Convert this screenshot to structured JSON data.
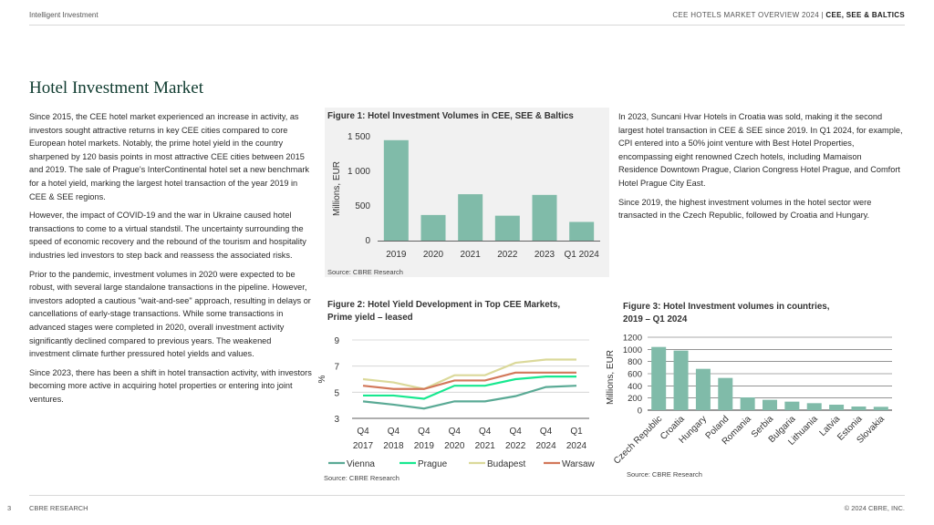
{
  "header": {
    "left": "Intelligent Investment",
    "right_main": "CEE HOTELS MARKET OVERVIEW 2024  |  ",
    "right_bold": "CEE, SEE & BALTICS"
  },
  "page_title": "Hotel Investment Market",
  "left_paragraphs": [
    "Since 2015, the CEE hotel market experienced an increase in activity, as investors sought attractive returns in key CEE cities compared to core European hotel markets. Notably, the prime hotel yield in the country sharpened by 120 basis points in most attractive CEE cities between 2015 and 2019. The sale of Prague's InterContinental hotel set a new benchmark for a hotel yield, marking the largest hotel transaction of the year 2019 in CEE & SEE regions.",
    "However, the impact of COVID-19 and the war in Ukraine caused hotel transactions to come to a virtual standstil. The uncertainty surrounding the speed of economic recovery and the rebound of the tourism and hospitality industries led investors to step back and reassess the associated risks.",
    "Prior to the pandemic, investment volumes in 2020 were expected to be robust, with several large standalone transactions in the pipeline. However, investors adopted a cautious \"wait-and-see\" approach, resulting in delays or cancellations of early-stage transactions. While some transactions in advanced stages were completed in 2020, overall investment activity significantly declined compared to previous years. The weakened investment climate further pressured hotel yields and values.",
    "Since 2023, there has been a shift in hotel transaction activity, with investors becoming more active in acquiring hotel properties or entering into joint ventures."
  ],
  "right_paragraphs": [
    "In 2023, Suncani Hvar Hotels in Croatia was sold, making it the second largest hotel transaction in CEE & SEE since 2019.  In Q1 2024, for example, CPI entered into a 50% joint venture with Best Hotel Properties, encompassing eight renowned Czech hotels, including Mamaison Residence Downtown Prague, Clarion Congress Hotel Prague, and Comfort Hotel Prague City East.",
    "Since 2019, the highest investment volumes in the hotel sector were transacted in the Czech Republic, followed by Croatia and Hungary."
  ],
  "figure1": {
    "title": "Figure 1: Hotel Investment Volumes in CEE, SEE & Baltics",
    "source": "Source: CBRE Research"
  },
  "figure2": {
    "title_line1": "Figure 2: Hotel Yield Development in Top CEE Markets,",
    "title_line2": "Prime yield – leased",
    "source": "Source: CBRE Research"
  },
  "figure3": {
    "title_line1": "Figure 3: Hotel Investment volumes in countries,",
    "title_line2": "2019 – Q1 2024",
    "source": "Source: CBRE Research"
  },
  "chart_data": [
    {
      "type": "bar",
      "title": "Figure 1: Hotel Investment Volumes in CEE, SEE & Baltics",
      "ylabel": "Millions, EUR",
      "categories": [
        "2019",
        "2020",
        "2021",
        "2022",
        "2023",
        "Q1 2024"
      ],
      "values": [
        1450,
        370,
        670,
        360,
        660,
        270
      ],
      "ylim": [
        0,
        1500
      ],
      "yticks": [
        "0",
        "500",
        "1 000",
        "1 500"
      ],
      "ytick_values": [
        0,
        500,
        1000,
        1500
      ],
      "grid": false,
      "color": "#80bba9"
    },
    {
      "type": "line",
      "title": "Figure 2: Hotel Yield Development in Top CEE Markets, Prime yield – leased",
      "ylabel": "%",
      "categories": [
        [
          "Q4",
          "2017"
        ],
        [
          "Q4",
          "2018"
        ],
        [
          "Q4",
          "2019"
        ],
        [
          "Q4",
          "2020"
        ],
        [
          "Q4",
          "2021"
        ],
        [
          "Q4",
          "2022"
        ],
        [
          "Q4",
          "2024"
        ],
        [
          "Q1",
          "2024"
        ]
      ],
      "ylim": [
        3,
        9
      ],
      "yticks": [
        3,
        5,
        7,
        9
      ],
      "grid": true,
      "legend": "bottom",
      "series": [
        {
          "name": "Vienna",
          "color": "#5aaa95",
          "values": [
            4.3,
            4.05,
            3.75,
            4.3,
            4.3,
            4.7,
            5.4,
            5.5
          ]
        },
        {
          "name": "Prague",
          "color": "#17e88f",
          "values": [
            4.75,
            4.75,
            4.5,
            5.5,
            5.5,
            6.0,
            6.2,
            6.2
          ]
        },
        {
          "name": "Budapest",
          "color": "#dbd99a",
          "values": [
            6.0,
            5.75,
            5.25,
            6.3,
            6.3,
            7.25,
            7.5,
            7.5
          ]
        },
        {
          "name": "Warsaw",
          "color": "#d2785a",
          "values": [
            5.5,
            5.25,
            5.25,
            5.9,
            5.9,
            6.5,
            6.5,
            6.5
          ]
        }
      ]
    },
    {
      "type": "bar",
      "title": "Figure 3: Hotel Investment volumes in countries, 2019 – Q1 2024",
      "ylabel": "Millions, EUR",
      "categories": [
        "Czech Republic",
        "Croatia",
        "Hungary",
        "Poland",
        "Romania",
        "Serbia",
        "Bulgaria",
        "Lithuania",
        "Latvia",
        "Estonia",
        "Slovakia"
      ],
      "values": [
        1040,
        980,
        680,
        530,
        210,
        170,
        140,
        115,
        90,
        60,
        55
      ],
      "ylim": [
        0,
        1200
      ],
      "yticks": [
        0,
        200,
        400,
        600,
        800,
        1000,
        1200
      ],
      "grid": true,
      "color": "#80bba9"
    }
  ],
  "footer": {
    "page_number": "3",
    "left": "CBRE RESEARCH",
    "right": "© 2024 CBRE, INC."
  }
}
